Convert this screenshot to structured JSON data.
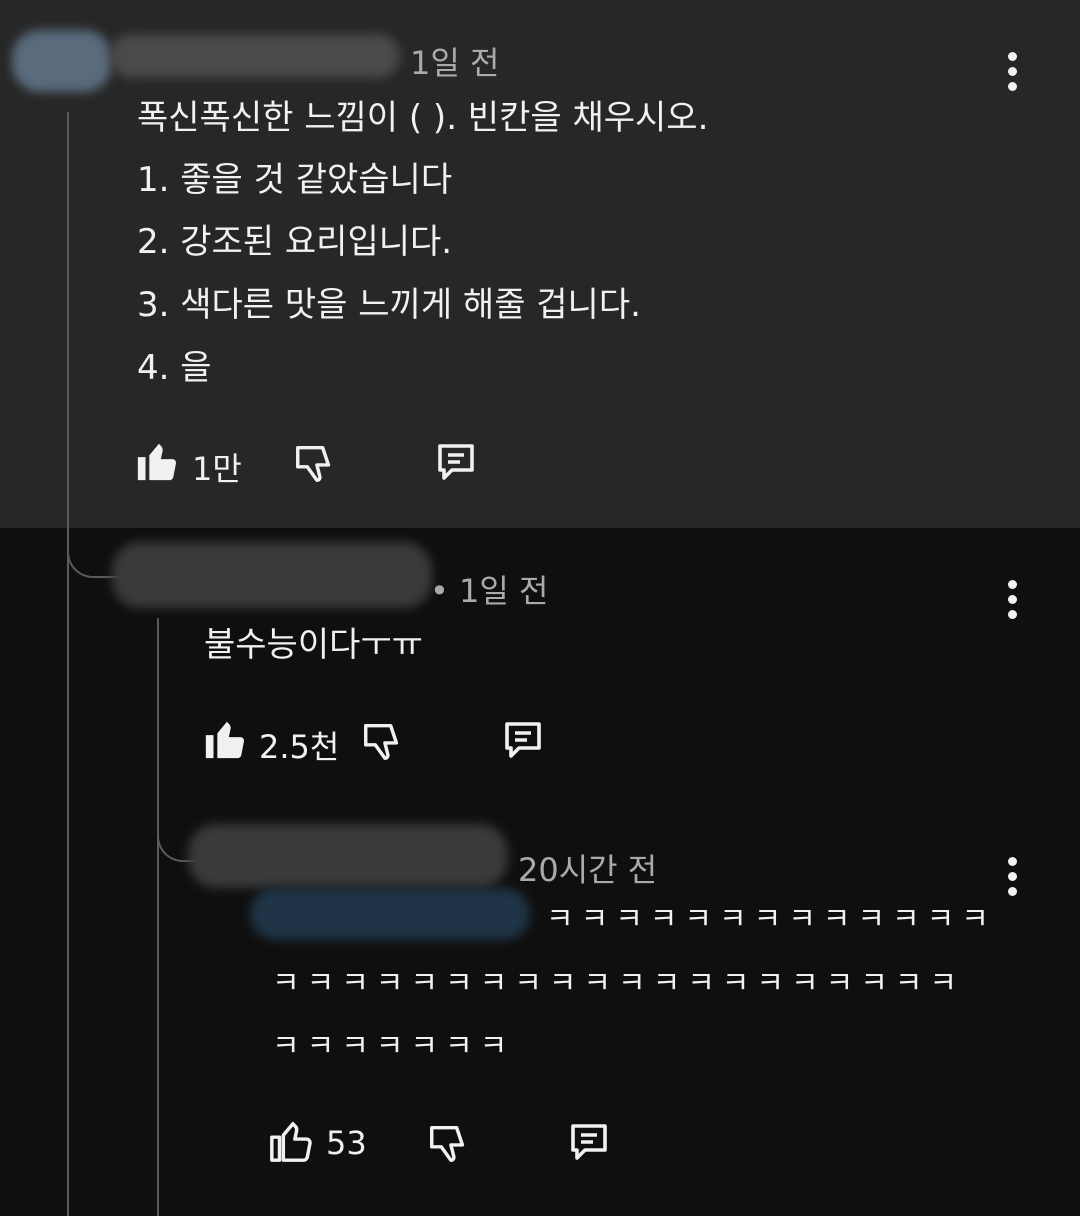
{
  "comment": {
    "time": "1일 전",
    "lines": [
      "폭신폭신한 느낌이 (                   ). 빈칸을 채우시오.",
      "1. 좋을 것 같았습니다",
      "2. 강조된 요리입니다.",
      "3. 색다른 맛을 느끼게 해줄 겁니다.",
      "4. 을"
    ],
    "likes": "1만"
  },
  "reply1": {
    "time": "• 1일 전",
    "text": "불수능이다ㅜㅠ",
    "likes": "2.5천"
  },
  "reply2": {
    "time": "20시간 전",
    "text_line1": "ㅋㅋㅋㅋㅋㅋㅋㅋㅋㅋㅋㅋㅋ",
    "text_line2": "ㅋㅋㅋㅋㅋㅋㅋㅋㅋㅋㅋㅋㅋㅋㅋㅋㅋㅋㅋㅋ",
    "text_line3": "ㅋㅋㅋㅋㅋㅋㅋ",
    "likes": "53"
  },
  "icons": {
    "like": "thumbs-up-icon",
    "dislike": "thumbs-down-icon",
    "reply": "comment-icon",
    "more": "more-vertical-icon"
  },
  "colors": {
    "top_panel": "#272727",
    "background": "#0f0f0f",
    "text": "#f1f1f1",
    "meta": "#aaaaaa"
  }
}
